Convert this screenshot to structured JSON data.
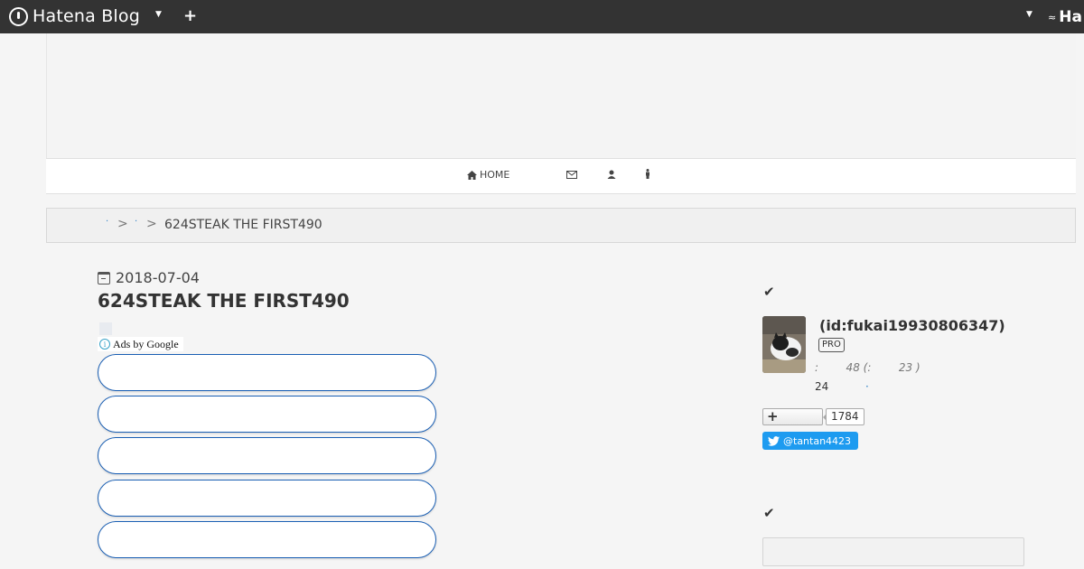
{
  "topbar": {
    "brand": "Hatena Blog",
    "right_brand": "Ha"
  },
  "nav": {
    "home_label": "HOME",
    "icons": [
      "envelope-icon",
      "user-pair-icon",
      "person-icon"
    ]
  },
  "breadcrumb": {
    "separator": ">",
    "current": "624STEAK THE FIRST490"
  },
  "entry": {
    "date": "2018-07-04",
    "title": "624STEAK THE FIRST490",
    "ads_label": "Ads by Google",
    "ad_slot_count": 5
  },
  "sidebar": {
    "profile": {
      "id": "(id:fukai19930806347)",
      "badge": "PRO",
      "stats": ":        48 (:        23 )",
      "count": "24",
      "follow_plus": "+",
      "follow_count": "1784",
      "twitter": "@tantan4423"
    }
  },
  "colors": {
    "topbar": "#333333",
    "twitter": "#1d9bf0",
    "ad_border": "#1a5fb4",
    "link": "#2a7ec4"
  }
}
